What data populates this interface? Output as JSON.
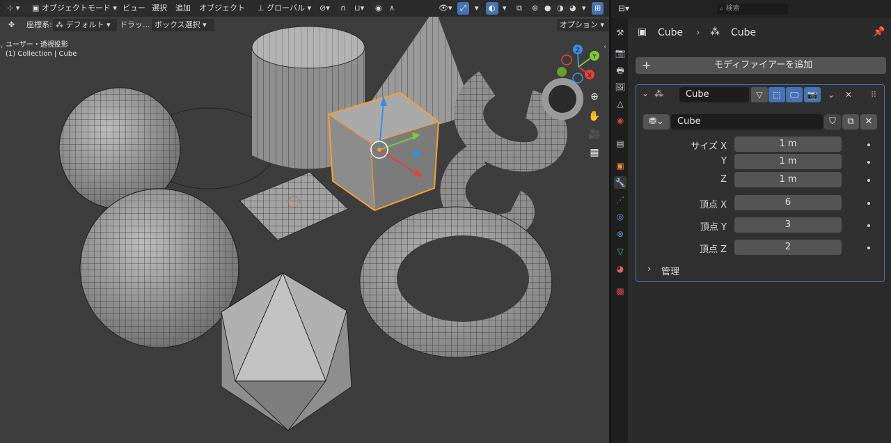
{
  "header": {
    "mode": "オブジェクトモード",
    "menu": [
      "ビュー",
      "選択",
      "追加",
      "オブジェクト"
    ],
    "transform_orientation": "グローバル",
    "row2": {
      "coord_label": "座標系:",
      "coord_value": "デフォルト",
      "drag_label": "ドラッ...",
      "drag_value": "ボックス選択",
      "options": "オプション"
    }
  },
  "viewport": {
    "view_name": "ユーザー・透視投影",
    "selection_info": "(1) Collection | Cube",
    "gizmo_axes": [
      "Z",
      "Y",
      "X"
    ]
  },
  "properties": {
    "search_placeholder": "検索",
    "breadcrumb": [
      "Cube",
      "Cube"
    ],
    "add_modifier": "モディファイアーを追加",
    "modifier": {
      "name": "Cube",
      "mesh_name": "Cube",
      "fields": [
        {
          "label": "サイズ X",
          "value": "1 m"
        },
        {
          "label": "Y",
          "value": "1 m"
        },
        {
          "label": "Z",
          "value": "1 m"
        },
        {
          "label": "頂点 X",
          "value": "6"
        },
        {
          "label": "頂点 Y",
          "value": "3"
        },
        {
          "label": "頂点 Z",
          "value": "2"
        }
      ],
      "section": "管理"
    }
  },
  "colors": {
    "accent": "#4772b3",
    "selection": "#f5a033",
    "axis_x": "#e8413c",
    "axis_y": "#7ec936",
    "axis_z": "#3c8de0"
  }
}
